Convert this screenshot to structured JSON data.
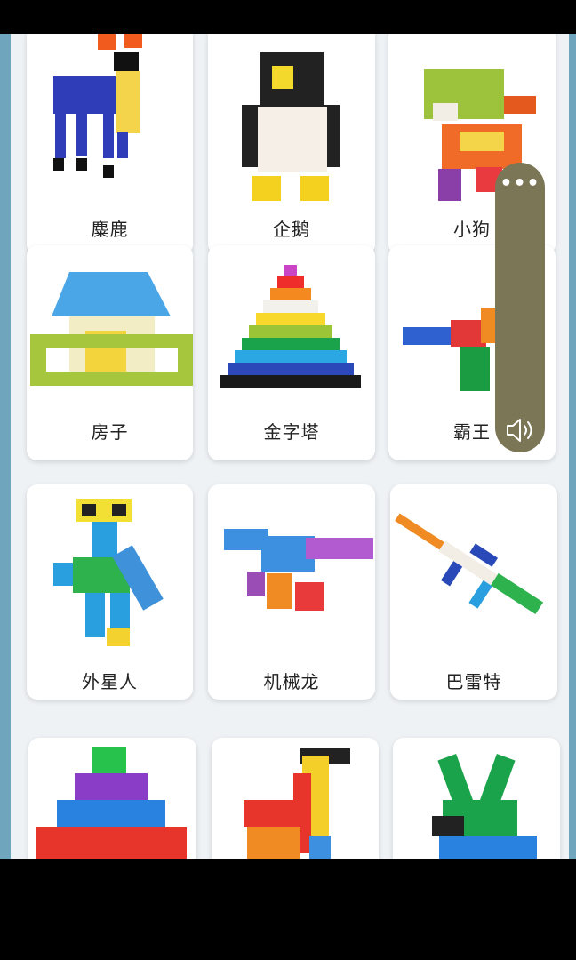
{
  "grid": {
    "cards": [
      {
        "label": "麋鹿"
      },
      {
        "label": "企鹅"
      },
      {
        "label": "小狗"
      },
      {
        "label": "房子"
      },
      {
        "label": "金字塔"
      },
      {
        "label": "霸王"
      },
      {
        "label": "外星人"
      },
      {
        "label": "机械龙"
      },
      {
        "label": "巴雷特"
      },
      {
        "label": ""
      },
      {
        "label": ""
      },
      {
        "label": ""
      }
    ]
  },
  "float_panel": {
    "more_icon": "more-dots-icon",
    "volume_icon": "speaker-icon",
    "color": "#7b7656"
  },
  "colors": {
    "page_bg": "#eef2f5",
    "side_border": "#6fa6bd"
  }
}
